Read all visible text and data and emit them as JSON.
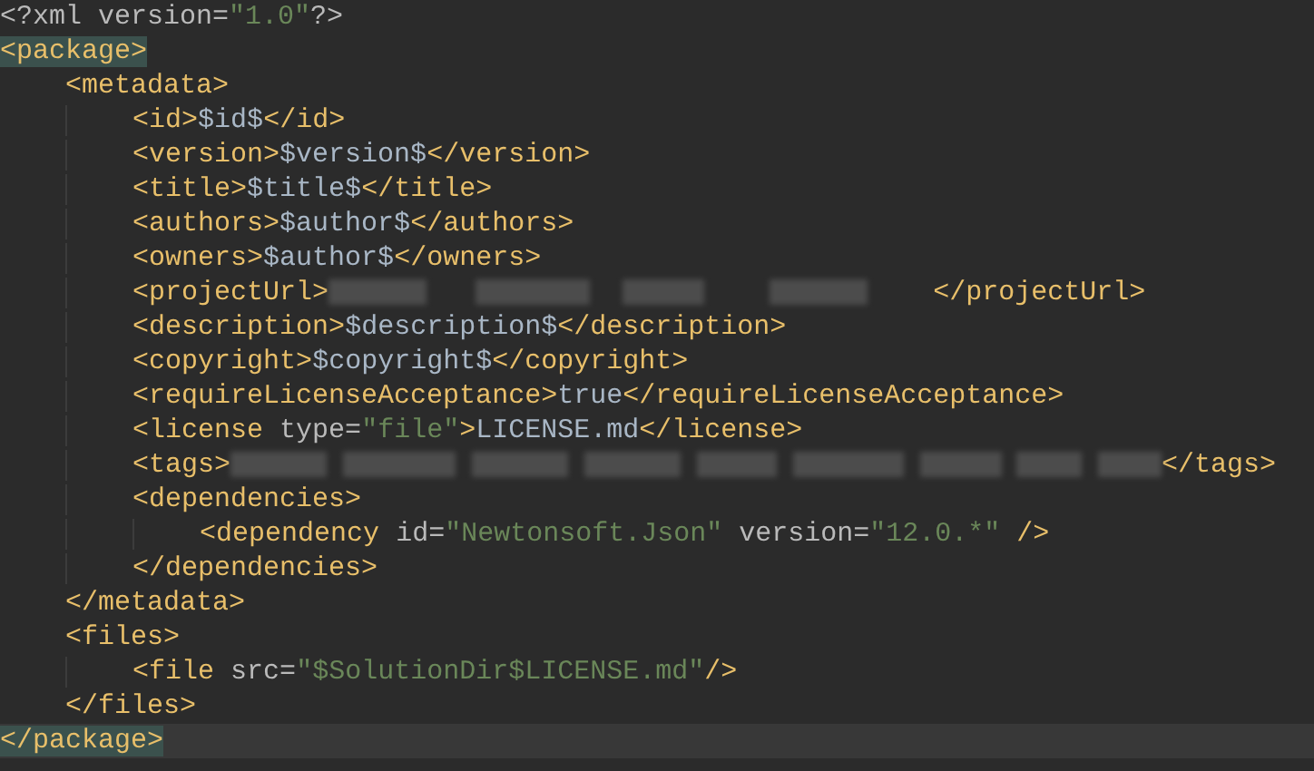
{
  "editor": {
    "lines": [
      {
        "current": false,
        "tokens": [
          {
            "kind": "attr",
            "text": "<?xml version="
          },
          {
            "kind": "string",
            "text": "\"1.0\""
          },
          {
            "kind": "attr",
            "text": "?>"
          }
        ]
      },
      {
        "current": false,
        "tokens": [
          {
            "kind": "tag",
            "text": "<package>",
            "matched": true
          }
        ]
      },
      {
        "current": false,
        "tokens": [
          {
            "kind": "tag",
            "text": "    <metadata>"
          }
        ]
      },
      {
        "current": false,
        "tokens": [
          {
            "kind": "tag",
            "text": "        <id>"
          },
          {
            "kind": "text",
            "text": "$id$"
          },
          {
            "kind": "tag",
            "text": "</id>"
          }
        ]
      },
      {
        "current": false,
        "tokens": [
          {
            "kind": "tag",
            "text": "        <version>"
          },
          {
            "kind": "text",
            "text": "$version$"
          },
          {
            "kind": "tag",
            "text": "</version>"
          }
        ]
      },
      {
        "current": false,
        "tokens": [
          {
            "kind": "tag",
            "text": "        <title>"
          },
          {
            "kind": "text",
            "text": "$title$"
          },
          {
            "kind": "tag",
            "text": "</title>"
          }
        ]
      },
      {
        "current": false,
        "tokens": [
          {
            "kind": "tag",
            "text": "        <authors>"
          },
          {
            "kind": "text",
            "text": "$author$"
          },
          {
            "kind": "tag",
            "text": "</authors>"
          }
        ]
      },
      {
        "current": false,
        "tokens": [
          {
            "kind": "tag",
            "text": "        <owners>"
          },
          {
            "kind": "text",
            "text": "$author$"
          },
          {
            "kind": "tag",
            "text": "</owners>"
          }
        ]
      },
      {
        "current": false,
        "tokens": [
          {
            "kind": "tag",
            "text": "        <projectUrl>"
          },
          {
            "kind": "redacted"
          },
          {
            "kind": "tag",
            "text": "</projectUrl>"
          }
        ]
      },
      {
        "current": false,
        "tokens": [
          {
            "kind": "tag",
            "text": "        <description>"
          },
          {
            "kind": "text",
            "text": "$description$"
          },
          {
            "kind": "tag",
            "text": "</description>"
          }
        ]
      },
      {
        "current": false,
        "tokens": [
          {
            "kind": "tag",
            "text": "        <copyright>"
          },
          {
            "kind": "text",
            "text": "$copyright$"
          },
          {
            "kind": "tag",
            "text": "</copyright>"
          }
        ]
      },
      {
        "current": false,
        "tokens": [
          {
            "kind": "tag",
            "text": "        <requireLicenseAcceptance>"
          },
          {
            "kind": "text",
            "text": "true"
          },
          {
            "kind": "tag",
            "text": "</requireLicenseAcceptance>"
          }
        ]
      },
      {
        "current": false,
        "tokens": [
          {
            "kind": "tag",
            "text": "        <license "
          },
          {
            "kind": "attr",
            "text": "type="
          },
          {
            "kind": "string",
            "text": "\"file\""
          },
          {
            "kind": "tag",
            "text": ">"
          },
          {
            "kind": "text",
            "text": "LICENSE.md"
          },
          {
            "kind": "tag",
            "text": "</license>"
          }
        ]
      },
      {
        "current": false,
        "tokens": [
          {
            "kind": "tag",
            "text": "        <tags>"
          },
          {
            "kind": "redacted"
          },
          {
            "kind": "tag",
            "text": "</tags>"
          }
        ]
      },
      {
        "current": false,
        "tokens": [
          {
            "kind": "tag",
            "text": "        <dependencies>"
          }
        ]
      },
      {
        "current": false,
        "tokens": [
          {
            "kind": "tag",
            "text": "            <dependency "
          },
          {
            "kind": "attr",
            "text": "id="
          },
          {
            "kind": "string",
            "text": "\"Newtonsoft.Json\""
          },
          {
            "kind": "attr",
            "text": " version="
          },
          {
            "kind": "string",
            "text": "\"12.0.*\""
          },
          {
            "kind": "tag",
            "text": " />"
          }
        ]
      },
      {
        "current": false,
        "tokens": [
          {
            "kind": "tag",
            "text": "        </dependencies>"
          }
        ]
      },
      {
        "current": false,
        "tokens": [
          {
            "kind": "tag",
            "text": "    </metadata>"
          }
        ]
      },
      {
        "current": false,
        "tokens": [
          {
            "kind": "tag",
            "text": "    <files>"
          }
        ]
      },
      {
        "current": false,
        "tokens": [
          {
            "kind": "tag",
            "text": "        <file "
          },
          {
            "kind": "attr",
            "text": "src="
          },
          {
            "kind": "string",
            "text": "\"$SolutionDir$LICENSE.md\""
          },
          {
            "kind": "tag",
            "text": "/>"
          }
        ]
      },
      {
        "current": false,
        "tokens": [
          {
            "kind": "tag",
            "text": "    </files>"
          }
        ]
      },
      {
        "current": true,
        "tokens": [
          {
            "kind": "tag",
            "text": "</package>",
            "matched": true
          }
        ]
      }
    ]
  }
}
